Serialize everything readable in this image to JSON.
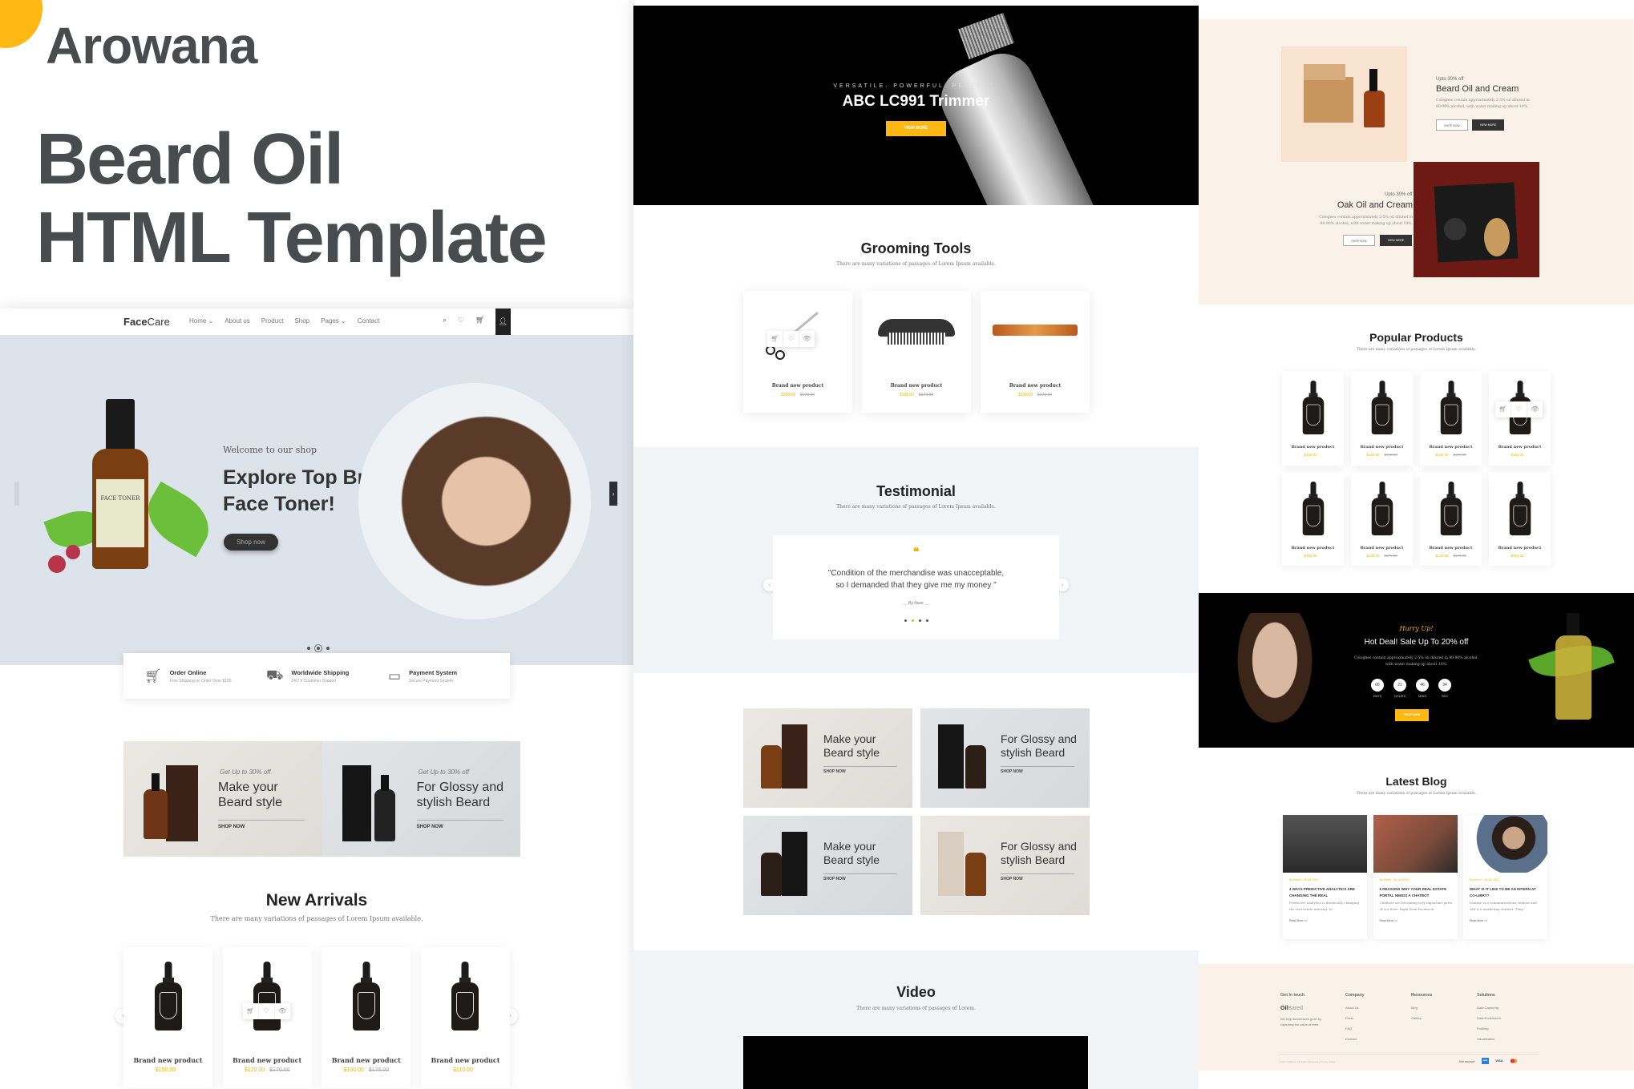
{
  "promo_header": {
    "brand": "Arowana",
    "headline_line1": "Beard Oil",
    "headline_line2": "HTML Template",
    "accent_color": "#fdb813"
  },
  "nav": {
    "logo_bold": "Face",
    "logo_light": "Care",
    "links": [
      "Home ⌄",
      "About us",
      "Product",
      "Shop",
      "Pages ⌄",
      "Contact"
    ],
    "icons": [
      "search-icon",
      "heart-icon",
      "cart-icon",
      "user-icon"
    ]
  },
  "hero": {
    "welcome": "Welcome to our shop",
    "title_line1": "Explore Top Brand",
    "title_line2": "Face Toner!",
    "button": "Shop now",
    "bottle_label": "FACE TONER",
    "slides": 3,
    "active_slide": 2
  },
  "features": [
    {
      "icon": "cart-icon",
      "title": "Order Online",
      "subtitle": "Free Shipping on Order Over $100"
    },
    {
      "icon": "truck-icon",
      "title": "Worldwide Shipping",
      "subtitle": "24/7 h Customer Support"
    },
    {
      "icon": "payment-icon",
      "title": "Payment System",
      "subtitle": "Secure Payment System"
    }
  ],
  "promos": [
    {
      "small": "Get Up to 30% off",
      "title_line1": "Make your",
      "title_line2": "Beard style",
      "link": "SHOP NOW"
    },
    {
      "small": "Get Up to 30% off",
      "title_line1": "For Glossy and",
      "title_line2": "stylish Beard",
      "link": "SHOP NOW"
    }
  ],
  "new_arrivals": {
    "title": "New Arrivals",
    "subtitle": "There are many variations of passages of Lorem Ipsum available.",
    "products": [
      {
        "name": "Brand new product",
        "price": "$150.00",
        "old_price": ""
      },
      {
        "name": "Brand new product",
        "price": "$120.00",
        "old_price": "$170.00"
      },
      {
        "name": "Brand new product",
        "price": "$130.00",
        "old_price": "$170.00"
      },
      {
        "name": "Brand new product",
        "price": "$110.00",
        "old_price": ""
      }
    ]
  },
  "trimmer": {
    "tagline": "VERSATILE. POWERFUL. PERFECT.",
    "title": "ABC LC991 Trimmer",
    "button": "VIEW MORE"
  },
  "grooming": {
    "title": "Grooming Tools",
    "subtitle": "There are many variations of passages of Lorem Ipsum available.",
    "products": [
      {
        "name": "Brand new product",
        "price": "$130.00",
        "old_price": "$170.00",
        "item": "scissors"
      },
      {
        "name": "Brand new product",
        "price": "$130.00",
        "old_price": "$170.00",
        "item": "mustache comb"
      },
      {
        "name": "Brand new product",
        "price": "$130.00",
        "old_price": "$170.00",
        "item": "comb"
      }
    ]
  },
  "testimonial": {
    "title": "Testimonial",
    "subtitle": "There are many variations of passages of Lorem Ipsum available.",
    "quote_line1": "\"Condition of the merchandise was unacceptable,",
    "quote_line2": "so I demanded that they give me my money \"",
    "author": "__ By Nasir __",
    "dots": 4,
    "active_dot": 2
  },
  "banners": [
    {
      "title_line1": "Make your",
      "title_line2": "Beard style",
      "link": "SHOP NOW"
    },
    {
      "title_line1": "For Glossy and",
      "title_line2": "stylish Beard",
      "link": "SHOP NOW"
    },
    {
      "title_line1": "Make your",
      "title_line2": "Beard style",
      "link": "SHOP NOW"
    },
    {
      "title_line1": "For Glossy and",
      "title_line2": "stylish Beard",
      "link": "SHOP NOW"
    }
  ],
  "video": {
    "title": "Video",
    "subtitle": "There are many variations of passages of Lorem."
  },
  "offers": [
    {
      "small": "Upto 30% off",
      "title": "Beard Oil and Cream",
      "desc_line1": "Colognes contain approximately 2-5% oil diluted in",
      "desc_line2": "80-90% alcohol, with water making up about 10%.",
      "btn_outline": "SHOP NOW",
      "btn_dark": "VIEW MORE"
    },
    {
      "small": "Upto 30% off",
      "title": "Oak Oil and Cream",
      "desc_line1": "Colognes contain approximately 2-5% oil diluted in",
      "desc_line2": "80-90% alcohol, with water making up about 10%.",
      "btn_outline": "SHOP NOW",
      "btn_dark": "VIEW MORE"
    }
  ],
  "popular": {
    "title": "Popular Products",
    "subtitle": "There are many variations of passages of Lorem Ipsum available.",
    "products": [
      {
        "name": "Brand new product",
        "price": "$150.00",
        "old_price": ""
      },
      {
        "name": "Brand new product",
        "price": "$130.00",
        "old_price": "$170.00"
      },
      {
        "name": "Brand new product",
        "price": "$130.00",
        "old_price": "$170.00"
      },
      {
        "name": "Brand new product",
        "price": "$110.00",
        "old_price": ""
      },
      {
        "name": "Brand new product",
        "price": "$150.00",
        "old_price": ""
      },
      {
        "name": "Brand new product",
        "price": "$130.00",
        "old_price": "$170.00"
      },
      {
        "name": "Brand new product",
        "price": "$130.00",
        "old_price": "$170.00"
      },
      {
        "name": "Brand new product",
        "price": "$110.00",
        "old_price": ""
      }
    ]
  },
  "deal": {
    "hurry": "Hurry Up!",
    "title": "Hot Deal! Sale Up To 20% off",
    "desc_line1": "Colognes contain approximately 2-5% oil diluted in 80-90% alcohol,",
    "desc_line2": "with water making up about 10%.",
    "countdown": [
      {
        "value": "06",
        "label": "DAYS"
      },
      {
        "value": "21",
        "label": "HOURS"
      },
      {
        "value": "46",
        "label": "MINS"
      },
      {
        "value": "34",
        "label": "SEC"
      }
    ],
    "button": "SHOP NOW"
  },
  "blog": {
    "title": "Latest Blog",
    "subtitle": "There are many variations of passages of Lorem Ipsum available.",
    "posts": [
      {
        "meta": "By Admin  -  18 Jul 2020",
        "title": "4 WAYS PREDICTIVE ANALYTICS ARE CHANGING THE REAL",
        "excerpt": "Predictive analytics is drastically changing the real estate industry. In",
        "more": "Read More >>"
      },
      {
        "meta": "By Admin  -  18 Jul 2020",
        "title": "5 REASONS WHY YOUR REAL ESTATE PORTAL NEEDS A CHATBOT",
        "excerpt": "Chatbots are becoming very important parts of our lives. Right from Facebook",
        "more": "Read More >>"
      },
      {
        "meta": "By Admin  -  18 Jul 2020",
        "title": "WHAT IS IT LIKE TO BE AN INTERN AT CO-LIBRY?",
        "excerpt": "Isomise is a communications student and Atif is a marketing student. They",
        "more": "Read More >>"
      }
    ]
  },
  "footer": {
    "get_in_touch": "Get In touch",
    "logo_bold": "Oil",
    "logo_light": "Bared",
    "about": "We help businesses grow by capturing the value of their",
    "columns": [
      {
        "head": "Company",
        "links": [
          "About Us",
          "Press",
          "FAQ",
          "Contact"
        ]
      },
      {
        "head": "Resources",
        "links": [
          "Blog",
          "Gallery"
        ]
      },
      {
        "head": "Solutions",
        "links": [
          "Data Capturing",
          "Data Enrichment",
          "Profiling",
          "Visualization"
        ]
      }
    ],
    "copyright": "©2020 OilBared. All Rights Reserved | Privacy Policy",
    "accept_label": "We accept",
    "payments": [
      "AMEX",
      "VISA",
      "MC"
    ]
  }
}
